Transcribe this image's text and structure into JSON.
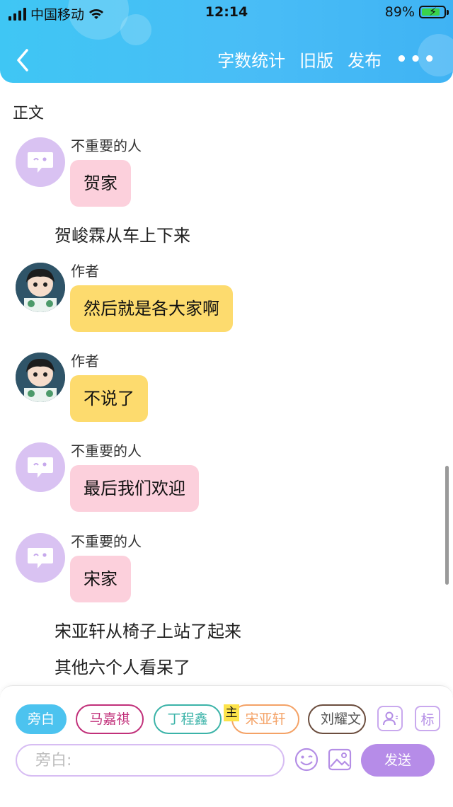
{
  "status_bar": {
    "carrier": "中国移动",
    "time": "12:14",
    "battery": "89%",
    "battery_level": 0.89
  },
  "header": {
    "back_icon": "chevron-left-icon",
    "actions": [
      "字数统计",
      "旧版",
      "发布"
    ],
    "more_icon": "more-dots-icon"
  },
  "section_title": "正文",
  "messages": [
    {
      "speaker": "不重要的人",
      "text": "贺家",
      "avatar": "chat-bubble-icon",
      "color": "#fcd0dc"
    },
    {
      "narration": "贺峻霖从车上下来"
    },
    {
      "speaker": "作者",
      "text": "然后就是各大家啊",
      "avatar": "author-avatar",
      "color": "#fddb6e"
    },
    {
      "speaker": "作者",
      "text": "不说了",
      "avatar": "author-avatar",
      "color": "#fddb6e"
    },
    {
      "speaker": "不重要的人",
      "text": "最后我们欢迎",
      "avatar": "chat-bubble-icon",
      "color": "#fcd0dc"
    },
    {
      "speaker": "不重要的人",
      "text": "宋家",
      "avatar": "chat-bubble-icon",
      "color": "#fcd0dc"
    },
    {
      "narration": "宋亚轩从椅子上站了起来"
    },
    {
      "narration": "其他六个人看呆了"
    }
  ],
  "composer": {
    "roles": [
      "旁白",
      "马嘉祺",
      "丁程鑫",
      "宋亚轩",
      "刘耀文"
    ],
    "main_badge": "主",
    "manage_roles_icon": "person-icon",
    "tag_button": "标",
    "input_placeholder": "旁白:",
    "emoji_icon": "smiley-icon",
    "image_icon": "image-icon",
    "send_label": "发送"
  },
  "colors": {
    "header": "#42c0f5",
    "accent_purple": "#b68ce8",
    "narrator_chip": "#4cc3ef"
  }
}
